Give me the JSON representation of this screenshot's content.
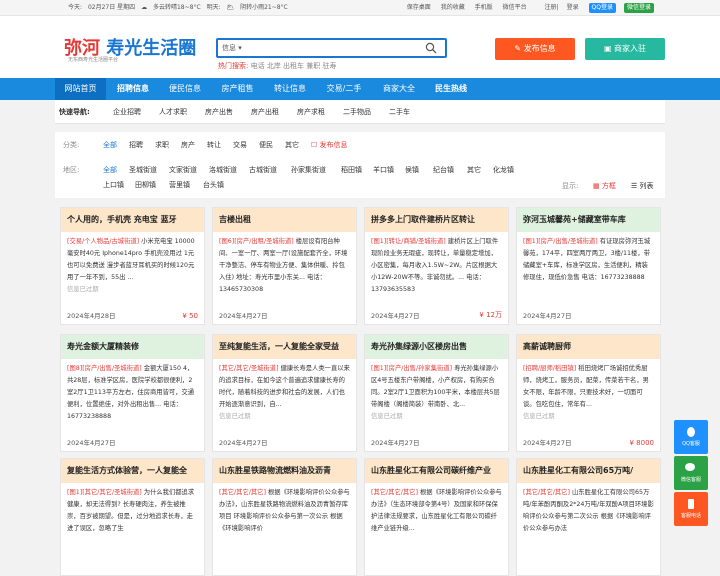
{
  "topbar": {
    "today_label": "今天:",
    "date": "02月27日 星期四",
    "weather_today": "多云转晴18~8°C",
    "tomorrow_label": "明天:",
    "weather_tomorrow": "阴转小雨21~8°C",
    "links": [
      "保存桌面",
      "我的收藏",
      "手机版",
      "微信平台"
    ],
    "register": "注册",
    "login": "登录",
    "qq_login": "QQ登录",
    "wx_login": "微信登录"
  },
  "header": {
    "logo_red": "弥河",
    "logo_blue": "寿光生活圈",
    "logo_sub": "无东西寿光生活圈平台",
    "search_select": "信息",
    "hot_label": "热门搜索:",
    "hot_terms": "电话 北岸 出租车 兼职 驻寿",
    "post_button": "发布信息",
    "join_button": "商家入驻"
  },
  "nav": [
    "网站首页",
    "招聘信息",
    "便民信息",
    "房产租售",
    "转让信息",
    "交易/二手",
    "商家大全",
    "民生热线"
  ],
  "quick": {
    "title": "快速导航:",
    "links": [
      "企业招聘",
      "人才求职",
      "房产出售",
      "房产出租",
      "房产求租",
      "二手物品",
      "二手车"
    ]
  },
  "filter": {
    "category_label": "分类:",
    "categories": [
      "全部",
      "招聘",
      "求职",
      "房产",
      "转让",
      "交易",
      "便民",
      "其它"
    ],
    "post_link": "发布信息",
    "region_label": "地区:",
    "regions_row1": [
      "全部",
      "圣城街道",
      "文家街道",
      "洛城街道",
      "古城街道",
      "孙家集街道",
      "稻田镇",
      "羊口镇",
      "侯镇",
      "纪台镇",
      "其它",
      "化龙镇"
    ],
    "regions_row2": [
      "上口镇",
      "田柳镇",
      "营里镇",
      "台头镇"
    ],
    "display_label": "显示:",
    "view_grid": "方框",
    "view_list": "列表"
  },
  "cards": [
    {
      "title": "个人用的，手机壳 充电宝 蓝牙",
      "tag": "[交易/个人物品/古城街道]",
      "body": "小米充电宝 10000毫安时40元 Iphone14pro 手机壳没用过 1元 也可以免费送 漫步者蓝牙耳机买的时候120元用了一年不到，55出 ...",
      "views": "信息已过期",
      "date": "2024年4月28日",
      "price": "¥ 50"
    },
    {
      "title": "吉楼出租",
      "tag": "[图6][房产/出租/圣城街道]",
      "body": "楼层设有阳台种间、一室一厅、两室一厅(设施配套齐全，环境干净整洁、停车有物业方便、集体供暖、拎包入住) 地址：寿光市里小东关... 电话：13465730308",
      "views": "",
      "date": "2024年4月27日",
      "price": ""
    },
    {
      "title": "拼多多上门取件建桥片区转让",
      "tag": "[图1][转让/商铺/圣城街道]",
      "body": "建桥片区上门取件现阶段业务无瑕疵，现转让，单量稳定增加，小区密集，每月收入1.5W~2W。片区根据大小12W-20W不等。非诚勿扰。... 电话：13793635583",
      "views": "",
      "date": "2024年4月27日",
      "price": "¥ 12万"
    },
    {
      "title": "弥河玉城馨苑+储藏室带车库",
      "tag": "[图1][房产/出售/圣城街道]",
      "body": "有证现房弥河玉城馨苑，174平，四室两厅两卫，3楼/11楼，带储藏室+车库，标准学区房，生活便利，精装修现住，现低价急售 电话：16773238888",
      "views": "",
      "date": "2024年4月27日",
      "price": ""
    },
    {
      "title": "寿光金额大厦精装修",
      "tag": "[图8][房产/出售/圣城街道]",
      "body": "金额大厦150 4，共28层，标准学区房，医院学校都很便利，2室2厅1卫113平方左右，住房商用皆可，交通便利，位置绝佳，对外出租出售... 电话：16773238888",
      "views": "",
      "date": "2024年4月27日",
      "price": ""
    },
    {
      "title": "至纯复能生活，一人复能全家受益",
      "tag": "[其它/其它/圣城街道]",
      "body": "健康长寿是人类一直以来的追求目标，在如今这个普遍追求健康长寿的时代，随着科技的进步和社会的发展，人们也开始逐渐意识到，自...",
      "views": "信息已过期",
      "date": "2024年4月27日",
      "price": ""
    },
    {
      "title": "寿光孙集绿源小区楼房出售",
      "tag": "[图1][房产/出售/孙家集街道]",
      "body": "寿光孙集绿源小区4号五楼东户带阁楼，小产权房，有购买合同。2室2厅1卫面积为100平米，本楼层共5层带阁楼（阁楼简装）带南卧、北...",
      "views": "信息已过期",
      "date": "2024年4月27日",
      "price": ""
    },
    {
      "title": "高薪诚聘厨师",
      "tag": "[招聘/厨师/稻田镇]",
      "body": "稻田烧烤厂场诚招优秀厨师，烧烤工，服务员，配菜，传菜若干名，男女不限，年龄不限，只要技术好，一切面可谈。包吃包住，常年有...",
      "views": "信息已过期",
      "date": "2024年4月27日",
      "price": "¥ 8000"
    },
    {
      "title": "复能生活方式体验营，一人复能全",
      "tag": "[图1][其它/其它/圣城街道]",
      "body": "为什么我们都追求健康，却无法得到? 长寿硬肉注，养生被推崇，百岁被期望。但是，过分地追求长寿，走进了误区，忽略了生",
      "views": "",
      "date": "",
      "price": ""
    },
    {
      "title": "山东胜星铁路物流燃料油及沥青",
      "tag": "[其它/其它/其它]",
      "body": "根据《环境影响评价公众参与办法》，山东胜星铁路物流燃料油及沥青暂存库项目 环境影响评价公众参与第一次公示 根据《环境影响评价",
      "views": "",
      "date": "",
      "price": ""
    },
    {
      "title": "山东胜星化工有限公司碳纤维产业",
      "tag": "[其它/其它/其它]",
      "body": "根据《环境影响评价公众参与办法》（生态环境部令第4号）及国家和环保保护法律法规要求，山东胜星化工有限公司碳纤维产业链升级...",
      "views": "",
      "date": "",
      "price": ""
    },
    {
      "title": "山东胜星化工有限公司65万吨/",
      "tag": "[其它/其它/其它]",
      "body": "山东胜星化工有限公司65万吨/年苯酚丙酮及2*24万吨/年双酚A项目环境影响评价公众参与第二次公示 根据《环境影响评价公众参与办法",
      "views": "",
      "date": "",
      "price": ""
    }
  ],
  "float": {
    "qq": "QQ客服",
    "wechat": "微信客服",
    "phone": "客服电话"
  },
  "colors": {
    "brand": "#1a8ade",
    "accent": "#ff5722",
    "green": "#26b9a0"
  }
}
